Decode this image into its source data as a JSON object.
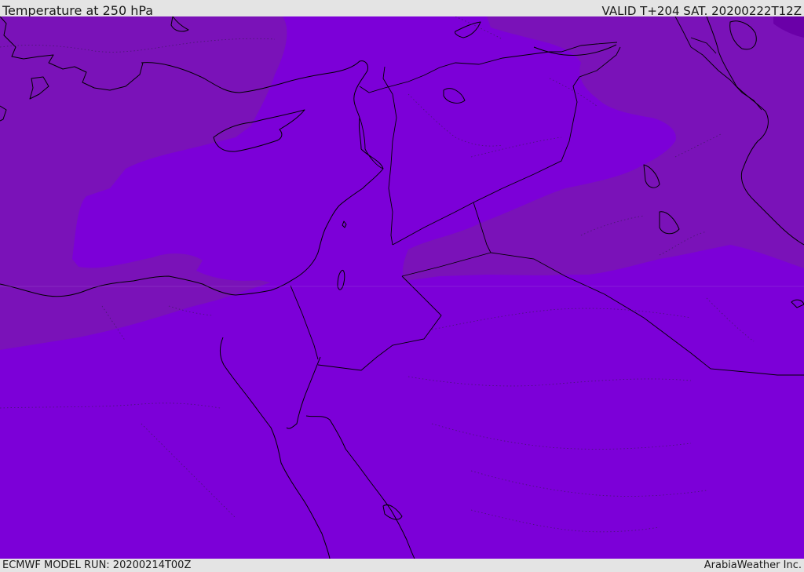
{
  "header": {
    "title": "Temperature at 250 hPa",
    "valid_time": "VALID T+204 SAT. 20200222T12Z"
  },
  "footer": {
    "model_run": "ECMWF MODEL RUN: 20200214T00Z",
    "credit": "ArabiaWeather Inc."
  },
  "map": {
    "field": "temperature",
    "level": "250 hPa",
    "colors": {
      "warm_band": "#7c00d8",
      "cold_band": "#7a12b8",
      "coldest_band": "#6a00a8",
      "coastline": "#000000"
    }
  }
}
